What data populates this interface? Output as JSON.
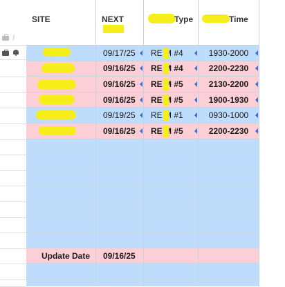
{
  "columns": {
    "site": "SITE",
    "next": "NEXT",
    "type": "Type",
    "time": "Time"
  },
  "rows": [
    {
      "color": "blue",
      "bold": false,
      "date": "09/17/25",
      "type": "RE  M #4",
      "time": "1930-2000"
    },
    {
      "color": "pink",
      "bold": true,
      "date": "09/16/25",
      "type": "RE  M #4",
      "time": "2200-2230"
    },
    {
      "color": "pink",
      "bold": true,
      "date": "09/16/25",
      "type": "RE  M #5",
      "time": "2130-2200"
    },
    {
      "color": "pink",
      "bold": true,
      "date": "09/16/25",
      "type": "RE  M #5",
      "time": "1900-1930"
    },
    {
      "color": "blue",
      "bold": false,
      "date": "09/19/25",
      "type": "RE  M #1",
      "time": "0930-1000"
    },
    {
      "color": "pink",
      "bold": true,
      "date": "09/16/25",
      "type": "RE  M #5",
      "time": "2200-2230"
    }
  ],
  "footer": {
    "label": "Update Date",
    "date": "09/16/25"
  },
  "colors": {
    "row_blue": "#bedcfb",
    "row_pink": "#fccfd6",
    "redaction": "#f6ee1a",
    "arrow": "#3a6fd6"
  }
}
